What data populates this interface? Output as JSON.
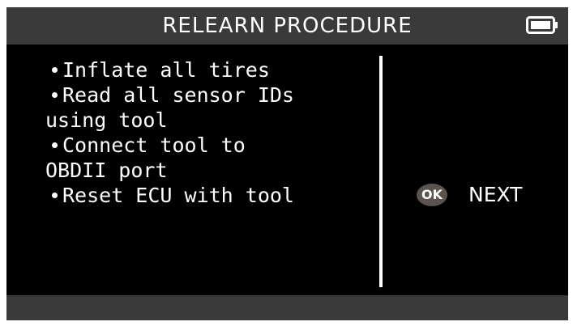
{
  "header": {
    "title": "RELEARN PROCEDURE",
    "battery_icon": "battery-full-icon"
  },
  "steps": [
    {
      "lines": [
        "Inflate all tires"
      ]
    },
    {
      "lines": [
        "Read all sensor IDs",
        "using tool"
      ]
    },
    {
      "lines": [
        "Connect tool to",
        "OBDII port"
      ]
    },
    {
      "lines": [
        "Reset ECU with tool"
      ]
    }
  ],
  "action": {
    "ok_label": "OK",
    "next_label": "NEXT"
  },
  "colors": {
    "background": "#000000",
    "bar": "#3a3a3a",
    "text": "#ffffff",
    "ok_badge": "#5b534f"
  }
}
